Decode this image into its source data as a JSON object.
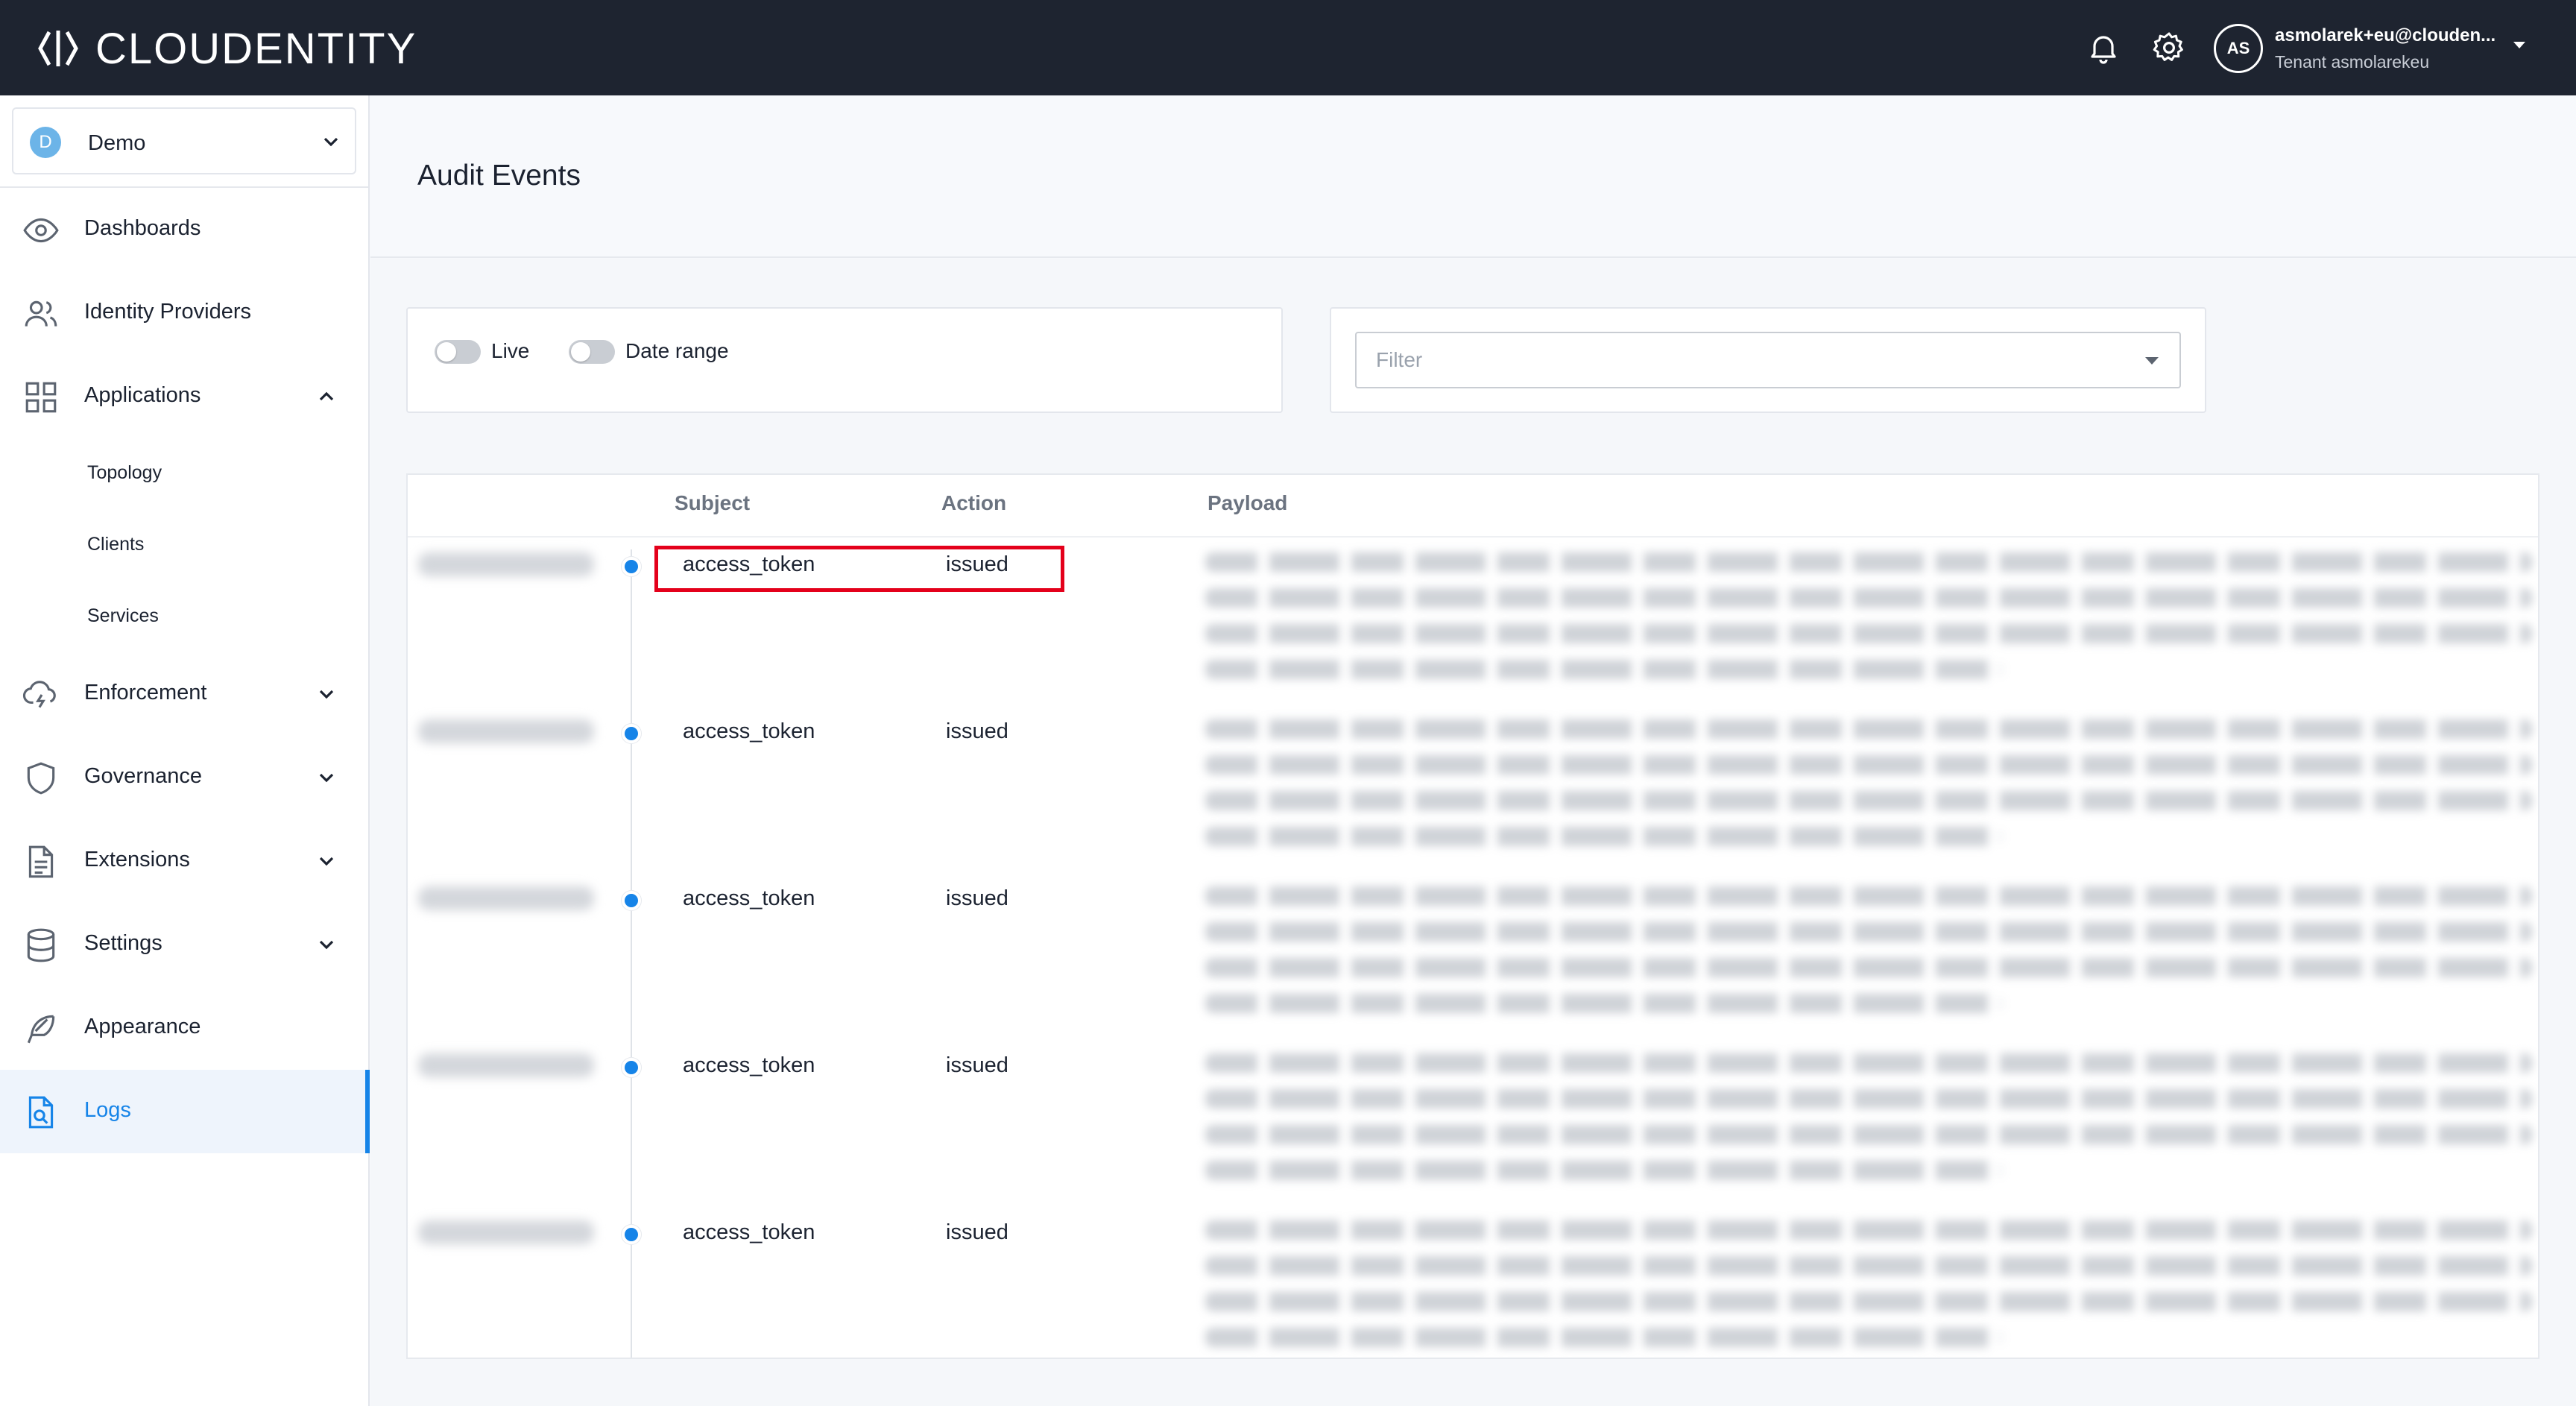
{
  "app": {
    "brand": "CLOUDENTITY",
    "user_initials": "AS",
    "user_email": "asmolarek+eu@clouden...",
    "tenant": "Tenant asmolarekeu"
  },
  "sidebar": {
    "workspace": {
      "badge": "D",
      "name": "Demo"
    },
    "items": [
      {
        "label": "Dashboards"
      },
      {
        "label": "Identity Providers"
      },
      {
        "label": "Applications"
      },
      {
        "label": "Enforcement"
      },
      {
        "label": "Governance"
      },
      {
        "label": "Extensions"
      },
      {
        "label": "Settings"
      },
      {
        "label": "Appearance"
      },
      {
        "label": "Logs"
      }
    ],
    "sub_items": [
      {
        "label": "Topology"
      },
      {
        "label": "Clients"
      },
      {
        "label": "Services"
      }
    ]
  },
  "page": {
    "title": "Audit Events",
    "live_label": "Live",
    "date_range_label": "Date range",
    "filter_placeholder": "Filter"
  },
  "table": {
    "headers": {
      "subject": "Subject",
      "action": "Action",
      "payload": "Payload"
    },
    "rows": [
      {
        "subject": "access_token",
        "action": "issued"
      },
      {
        "subject": "access_token",
        "action": "issued"
      },
      {
        "subject": "access_token",
        "action": "issued"
      },
      {
        "subject": "access_token",
        "action": "issued"
      },
      {
        "subject": "access_token",
        "action": "issued"
      }
    ]
  },
  "colors": {
    "accent": "#1684e8",
    "topbar": "#1e2430",
    "highlight": "#e4001b"
  }
}
